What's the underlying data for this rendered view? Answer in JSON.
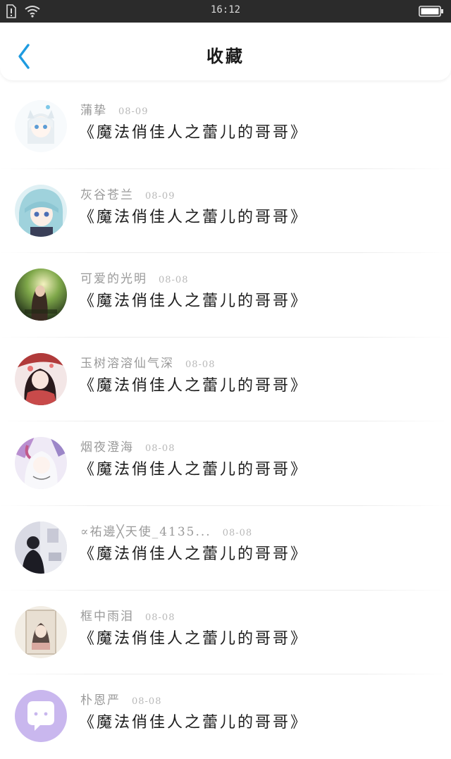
{
  "status_bar": {
    "time": "16:12"
  },
  "header": {
    "title": "收藏"
  },
  "colors": {
    "accent": "#1e9be0",
    "status_bar_bg": "#2b2b2b"
  },
  "items": [
    {
      "name": "蒲挚",
      "date": "08-09",
      "title": "《魔法俏佳人之蕾儿的哥哥》"
    },
    {
      "name": "灰谷苍兰",
      "date": "08-09",
      "title": "《魔法俏佳人之蕾儿的哥哥》"
    },
    {
      "name": "可爱的光明",
      "date": "08-08",
      "title": "《魔法俏佳人之蕾儿的哥哥》"
    },
    {
      "name": "玉树溶溶仙气深",
      "date": "08-08",
      "title": "《魔法俏佳人之蕾儿的哥哥》"
    },
    {
      "name": "烟夜澄海",
      "date": "08-08",
      "title": "《魔法俏佳人之蕾儿的哥哥》"
    },
    {
      "name": "∝祐邊╳天使_4135...",
      "date": "08-08",
      "title": "《魔法俏佳人之蕾儿的哥哥》"
    },
    {
      "name": "框中雨泪",
      "date": "08-08",
      "title": "《魔法俏佳人之蕾儿的哥哥》"
    },
    {
      "name": "朴恩严",
      "date": "08-08",
      "title": "《魔法俏佳人之蕾儿的哥哥》"
    }
  ]
}
